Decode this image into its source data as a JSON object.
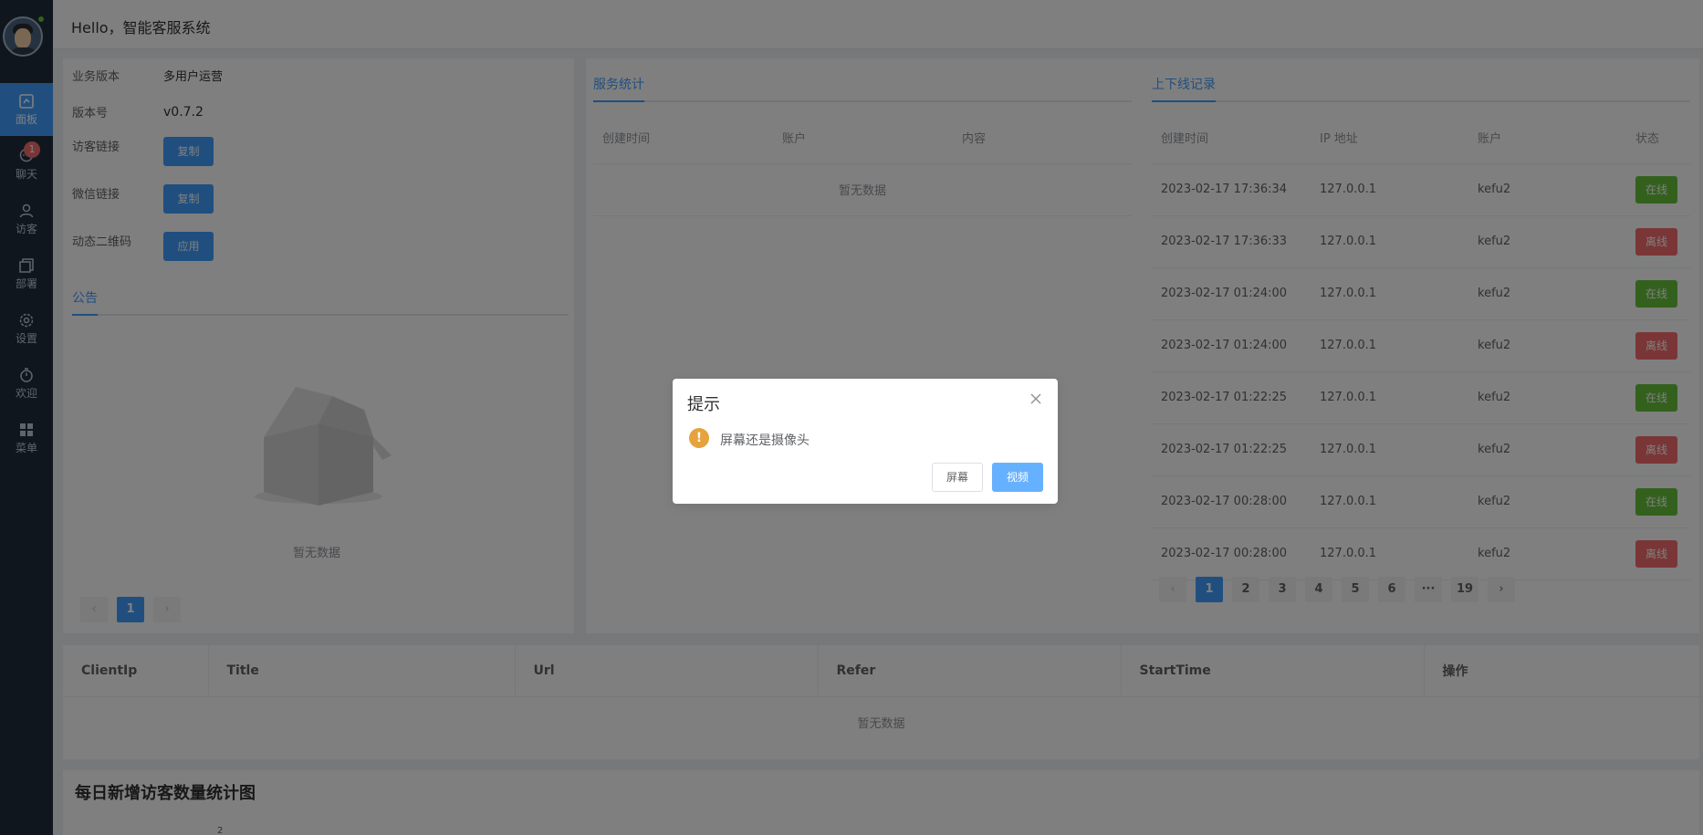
{
  "header": {
    "title": "Hello，智能客服系统"
  },
  "sidebar": {
    "items": [
      {
        "label": "面板",
        "icon": "dashboard-icon",
        "active": true
      },
      {
        "label": "聊天",
        "icon": "chat-icon",
        "badge": "1"
      },
      {
        "label": "访客",
        "icon": "user-icon"
      },
      {
        "label": "部署",
        "icon": "deploy-icon"
      },
      {
        "label": "设置",
        "icon": "gear-icon"
      },
      {
        "label": "欢迎",
        "icon": "timer-icon"
      },
      {
        "label": "菜单",
        "icon": "grid-icon"
      }
    ]
  },
  "info": {
    "version_label": "业务版本",
    "version_value": "多用户运营",
    "number_label": "版本号",
    "number_value": "v0.7.2",
    "visitor_link_label": "访客链接",
    "visitor_link_button": "复制",
    "wechat_link_label": "微信链接",
    "wechat_link_button": "复制",
    "qrcode_label": "动态二维码",
    "qrcode_button": "应用"
  },
  "notice": {
    "tab": "公告",
    "empty_text": "暂无数据",
    "pager": [
      "1"
    ]
  },
  "service_stats": {
    "tab": "服务统计",
    "columns": [
      "创建时间",
      "账户",
      "内容"
    ],
    "empty_text": "暂无数据"
  },
  "online_records": {
    "tab": "上下线记录",
    "columns": [
      "创建时间",
      "IP 地址",
      "账户",
      "状态"
    ],
    "rows": [
      {
        "time": "2023-02-17 17:36:34",
        "ip": "127.0.0.1",
        "account": "kefu2",
        "status": "在线",
        "status_type": "online"
      },
      {
        "time": "2023-02-17 17:36:33",
        "ip": "127.0.0.1",
        "account": "kefu2",
        "status": "离线",
        "status_type": "offline"
      },
      {
        "time": "2023-02-17 01:24:00",
        "ip": "127.0.0.1",
        "account": "kefu2",
        "status": "在线",
        "status_type": "online"
      },
      {
        "time": "2023-02-17 01:24:00",
        "ip": "127.0.0.1",
        "account": "kefu2",
        "status": "离线",
        "status_type": "offline"
      },
      {
        "time": "2023-02-17 01:22:25",
        "ip": "127.0.0.1",
        "account": "kefu2",
        "status": "在线",
        "status_type": "online"
      },
      {
        "time": "2023-02-17 01:22:25",
        "ip": "127.0.0.1",
        "account": "kefu2",
        "status": "离线",
        "status_type": "offline"
      },
      {
        "time": "2023-02-17 00:28:00",
        "ip": "127.0.0.1",
        "account": "kefu2",
        "status": "在线",
        "status_type": "online"
      },
      {
        "time": "2023-02-17 00:28:00",
        "ip": "127.0.0.1",
        "account": "kefu2",
        "status": "离线",
        "status_type": "offline"
      }
    ],
    "pager": [
      "1",
      "2",
      "3",
      "4",
      "5",
      "6",
      "···",
      "19"
    ],
    "current_page": "1"
  },
  "visitor_table": {
    "columns": [
      "ClientIp",
      "Title",
      "Url",
      "Refer",
      "StartTime",
      "操作"
    ],
    "empty_text": "暂无数据"
  },
  "chart": {
    "title": "每日新增访客数量统计图",
    "first_tick": "2"
  },
  "dialog": {
    "title": "提示",
    "message": "屏幕还是摄像头",
    "screen_button": "屏幕",
    "video_button": "视频"
  },
  "colors": {
    "primary": "#409eff",
    "online": "#67c23a",
    "offline": "#f56c6c",
    "warning": "#e6a23c",
    "sidebar": "#1f2d3d"
  }
}
